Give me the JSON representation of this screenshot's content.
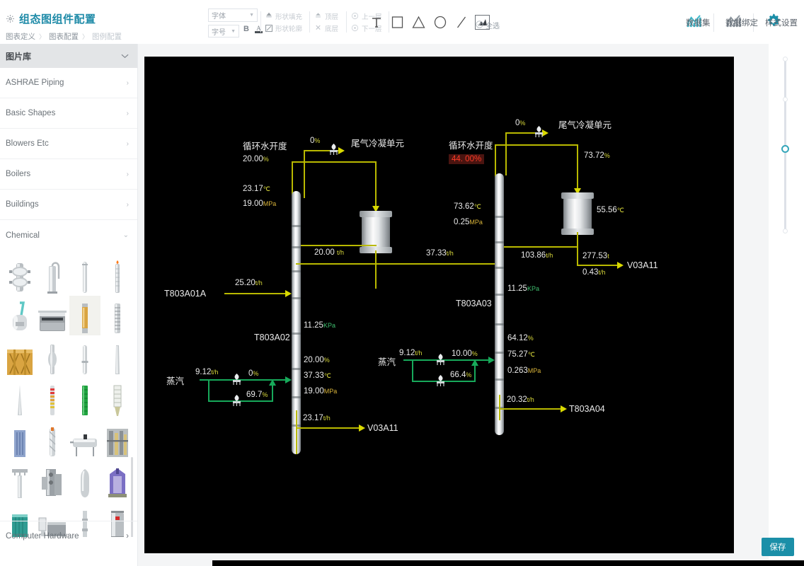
{
  "header": {
    "gear_icon": "gear-icon",
    "title": "组态图组件配置",
    "breadcrumb": [
      "图表定义",
      "图表配置",
      "图例配置"
    ],
    "breadcrumb_sep": "〉"
  },
  "toolbar": {
    "font_family_placeholder": "字体",
    "font_size_placeholder": "字号",
    "bold_label": "B",
    "font_color_icon": "font-color-icon",
    "shape_fill_label": "形状填充",
    "shape_outline_label": "形状轮廓",
    "top_layer_label": "顶层",
    "bottom_layer_label": "底层",
    "up_layer_label": "上一层",
    "down_layer_label": "下一层",
    "select_all_label": "全选",
    "tools": [
      {
        "name": "text-tool",
        "glyph": "T"
      },
      {
        "name": "rectangle-tool",
        "glyph": "▭"
      },
      {
        "name": "triangle-tool",
        "glyph": "△"
      },
      {
        "name": "ellipse-tool",
        "glyph": "◯"
      },
      {
        "name": "line-tool",
        "glyph": "╱"
      },
      {
        "name": "image-tool",
        "glyph": "🖼"
      }
    ]
  },
  "header_actions": [
    {
      "name": "dataset-button",
      "label": "数据集",
      "icon": "chart-bars-icon",
      "color": "#3bb6c8"
    },
    {
      "name": "data-binding-button",
      "label": "数据绑定",
      "icon": "chart-bars-icon",
      "color": "#7f8a93"
    },
    {
      "name": "style-settings-button",
      "label": "样式设置",
      "icon": "gear-icon",
      "color": "#1b8fa8"
    }
  ],
  "sidebar": {
    "title": "图片库",
    "collapse_icon": "chevron-down-icon",
    "categories": [
      {
        "label": "ASHRAE Piping",
        "expanded": false
      },
      {
        "label": "Basic Shapes",
        "expanded": false
      },
      {
        "label": "Blowers Etc",
        "expanded": false
      },
      {
        "label": "Boilers",
        "expanded": false
      },
      {
        "label": "Buildings",
        "expanded": false
      },
      {
        "label": "Chemical",
        "expanded": true
      }
    ],
    "bottom_category": {
      "label": "Computer Hardware",
      "expanded": false
    }
  },
  "canvas": {
    "background": "#000000",
    "diagram": {
      "left_unit": {
        "cooling_water_label": "循环水开度",
        "cooling_water_value": "20.00",
        "cooling_water_unit": "%",
        "temperature": "23.17",
        "temperature_unit": "℃",
        "pressure": "19.00",
        "pressure_unit": "MPa",
        "valve_open": "0",
        "valve_open_unit": "%",
        "tail_gas_unit_label": "尾气冷凝单元",
        "reflux_flow": "20.00",
        "reflux_flow_unit": "t/h",
        "feed_tag": "T803A01A",
        "feed_flow": "25.20",
        "feed_flow_unit": "t/h",
        "tower_tag": "T803A02",
        "vacuum": "11.25",
        "vacuum_unit": "KPa",
        "level": "20.00",
        "level_unit": "%",
        "bottom_temp": "37.33",
        "bottom_temp_unit": "℃",
        "bottom_pressure": "19.00",
        "bottom_pressure_unit": "MPa",
        "steam_label": "蒸汽",
        "steam_flow": "9.12",
        "steam_flow_unit": "t/h",
        "steam_valve_a": "0",
        "steam_valve_a_unit": "%",
        "steam_valve_b": "69.7",
        "steam_valve_b_unit": "%",
        "outlet_flow": "23.17",
        "outlet_flow_unit": "t/h",
        "outlet_tag": "V03A11"
      },
      "middle": {
        "transfer_flow": "37.33",
        "transfer_flow_unit": "t/h"
      },
      "right_unit": {
        "cooling_water_label": "循环水开度",
        "cooling_water_value": "44. 00%",
        "highlight_color": "#ff3b26",
        "highlight_bg": "#4a1410",
        "valve_open": "0",
        "valve_open_unit": "%",
        "tail_gas_unit_label": "尾气冷凝单元",
        "reflux_pct": "73.72",
        "reflux_pct_unit": "%",
        "temperature": "73.62",
        "temperature_unit": "℃",
        "pressure": "0.25",
        "pressure_unit": "MPa",
        "condenser_temp": "55.56",
        "condenser_temp_unit": "℃",
        "reflux_flow": "103.86",
        "reflux_flow_unit": "t/h",
        "product_flow": "277.53",
        "product_flow_unit": "t",
        "product_flow2": "0.43",
        "product_flow2_unit": "t/h",
        "product_tag": "V03A11",
        "tower_tag": "T803A03",
        "vacuum": "11.25",
        "vacuum_unit": "KPa",
        "level": "64.12",
        "level_unit": "%",
        "bottom_temp": "75.27",
        "bottom_temp_unit": "℃",
        "bottom_pressure": "0.263",
        "bottom_pressure_unit": "MPa",
        "steam_label": "蒸汽",
        "steam_flow": "9.12",
        "steam_flow_unit": "t/h",
        "steam_valve_a": "10.00",
        "steam_valve_a_unit": "%",
        "steam_valve_b": "66.4",
        "steam_valve_b_unit": "%",
        "outlet_flow": "20.32",
        "outlet_flow_unit": "t/h",
        "outlet_tag": "T803A04"
      }
    }
  },
  "right_panel": {
    "slider_name": "zoom-slider",
    "save_label": "保存"
  }
}
